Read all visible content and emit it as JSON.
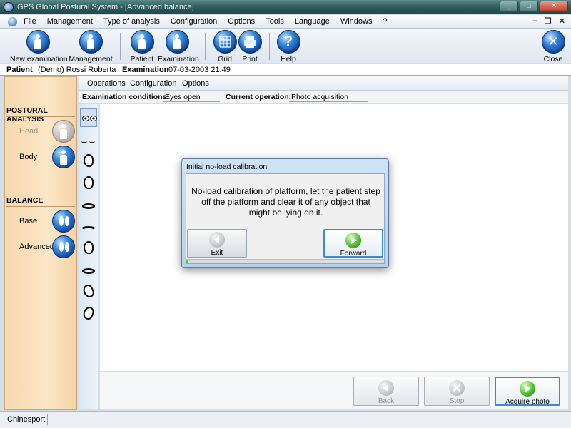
{
  "window": {
    "title": "GPS Global Postural System - [Advanced balance]",
    "minimize": "_",
    "maximize": "□",
    "close": "✕"
  },
  "menu": {
    "items": [
      "File",
      "Management",
      "Type of analysis",
      "Configuration",
      "Options",
      "Tools",
      "Language",
      "Windows",
      "?"
    ],
    "mdi_min": "–",
    "mdi_restore": "❐",
    "mdi_close": "✕"
  },
  "toolbar": {
    "new_examination": "New examination",
    "management": "Management",
    "patient": "Patient",
    "examination": "Examination",
    "grid": "Grid",
    "print": "Print",
    "help": "Help",
    "help_glyph": "?",
    "close": "Close",
    "close_glyph": "✕"
  },
  "patient_bar": {
    "patient_label": "Patient",
    "patient_value": "(Demo) Rossi Roberta",
    "exam_label": "Examination",
    "exam_value": "07-03-2003 21.49"
  },
  "left_panel": {
    "postural_title": "POSTURAL ANALYSIS",
    "head": "Head",
    "body": "Body",
    "balance_title": "BALANCE",
    "base": "Base",
    "advanced": "Advanced"
  },
  "sub_toolbar": {
    "operations": "Operations",
    "configuration": "Configuration",
    "options": "Options"
  },
  "conditions": {
    "exam_conditions_label": "Examination conditions:",
    "exam_conditions_value": "Eyes open",
    "current_op_label": "Current operation:",
    "current_op_value": "Photo acquisition"
  },
  "dialog": {
    "title": "Initial no-load calibration",
    "message": "No-load calibration of platform, let the patient step off the platform and clear it of any object that might be lying on it.",
    "exit": "Exit",
    "forward": "Forward",
    "progress": 0.01
  },
  "bottom_buttons": {
    "back": "Back",
    "stop": "Stop",
    "acquire": "Acquire photo"
  },
  "status": {
    "company": "Chinesport"
  },
  "colors": {
    "title_bar": "#2e5c5e",
    "left_panel": "#fbe6c6",
    "accent_blue": "#3c8ad6",
    "forward_green": "#4fbf33"
  }
}
